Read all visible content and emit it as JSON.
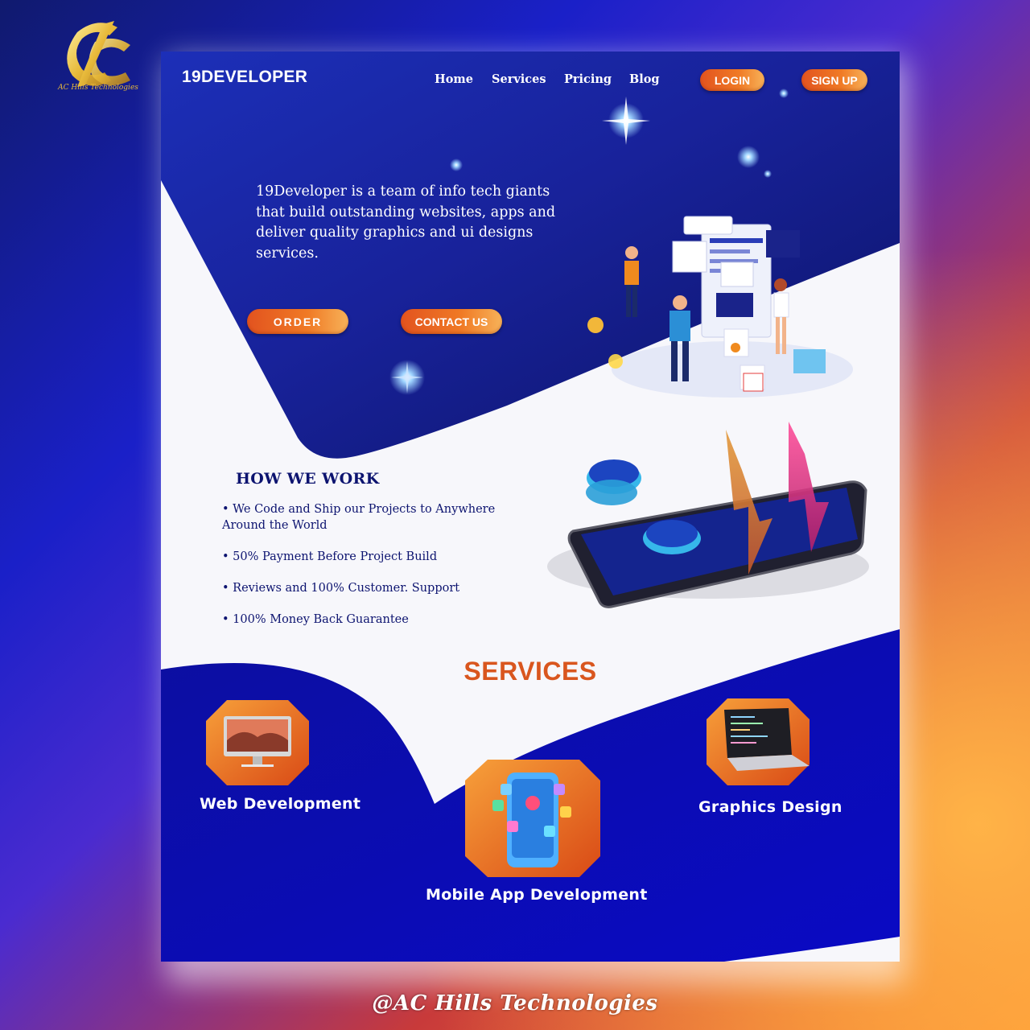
{
  "brand": {
    "name": "AC Hills Technologies",
    "credit": "@AC Hills Technologies"
  },
  "site": {
    "logo": "19DEVELOPER",
    "nav": [
      {
        "label": "Home"
      },
      {
        "label": "Services"
      },
      {
        "label": "Pricing"
      },
      {
        "label": "Blog"
      }
    ],
    "login_label": "LOGIN",
    "signup_label": "SIGN UP"
  },
  "hero": {
    "text": "19Developer is a team of info tech giants that build outstanding websites, apps and deliver quality graphics and ui designs services.",
    "order_label": "ORDER",
    "contact_label": "CONTACT US"
  },
  "how_we_work": {
    "title": "HOW WE WORK",
    "items": [
      "• We Code and Ship our Projects to Anywhere Around the World",
      "• 50% Payment Before Project Build",
      "• Reviews and 100% Customer. Support",
      "• 100% Money Back Guarantee"
    ]
  },
  "services": {
    "title": "SERVICES",
    "items": [
      {
        "label": "Web Development",
        "icon": "desktop-computer-icon"
      },
      {
        "label": "Mobile App Development",
        "icon": "mobile-apps-icon"
      },
      {
        "label": "Graphics Design",
        "icon": "laptop-code-icon"
      }
    ]
  },
  "colors": {
    "navy": "#0d1470",
    "blue": "#1a1fc8",
    "orange": "#f07a25",
    "gold": "#e7b93a"
  }
}
